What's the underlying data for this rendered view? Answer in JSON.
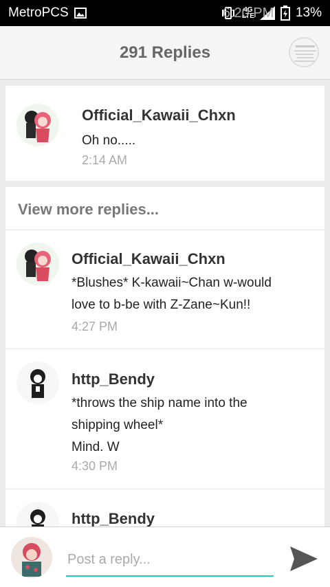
{
  "status": {
    "carrier": "MetroPCS",
    "network": "4G",
    "network_sub": "LTE",
    "battery": "13%",
    "time": "6:20 PM"
  },
  "header": {
    "title": "291 Replies"
  },
  "top_comment": {
    "username": "Official_Kawaii_Chxn",
    "text": "Oh no.....",
    "time": "2:14 AM"
  },
  "view_more_label": "View more replies...",
  "replies": [
    {
      "username": "Official_Kawaii_Chxn",
      "text": "*Blushes* K-kawaii~Chan w-would\nlove to b-be with Z-Zane~Kun!!",
      "time": "4:27 PM"
    },
    {
      "username": "http_Bendy",
      "text": "*throws the ship name into the\nshipping wheel*\nMind. W",
      "time": "4:30 PM"
    },
    {
      "username": "http_Bendy",
      "text": "",
      "time": ""
    }
  ],
  "composer": {
    "placeholder": "Post a reply..."
  },
  "colors": {
    "accent": "#2ec4c4",
    "status_bar": "#000000",
    "header_bg": "#f5f5f5",
    "page_bg": "#ececec"
  }
}
